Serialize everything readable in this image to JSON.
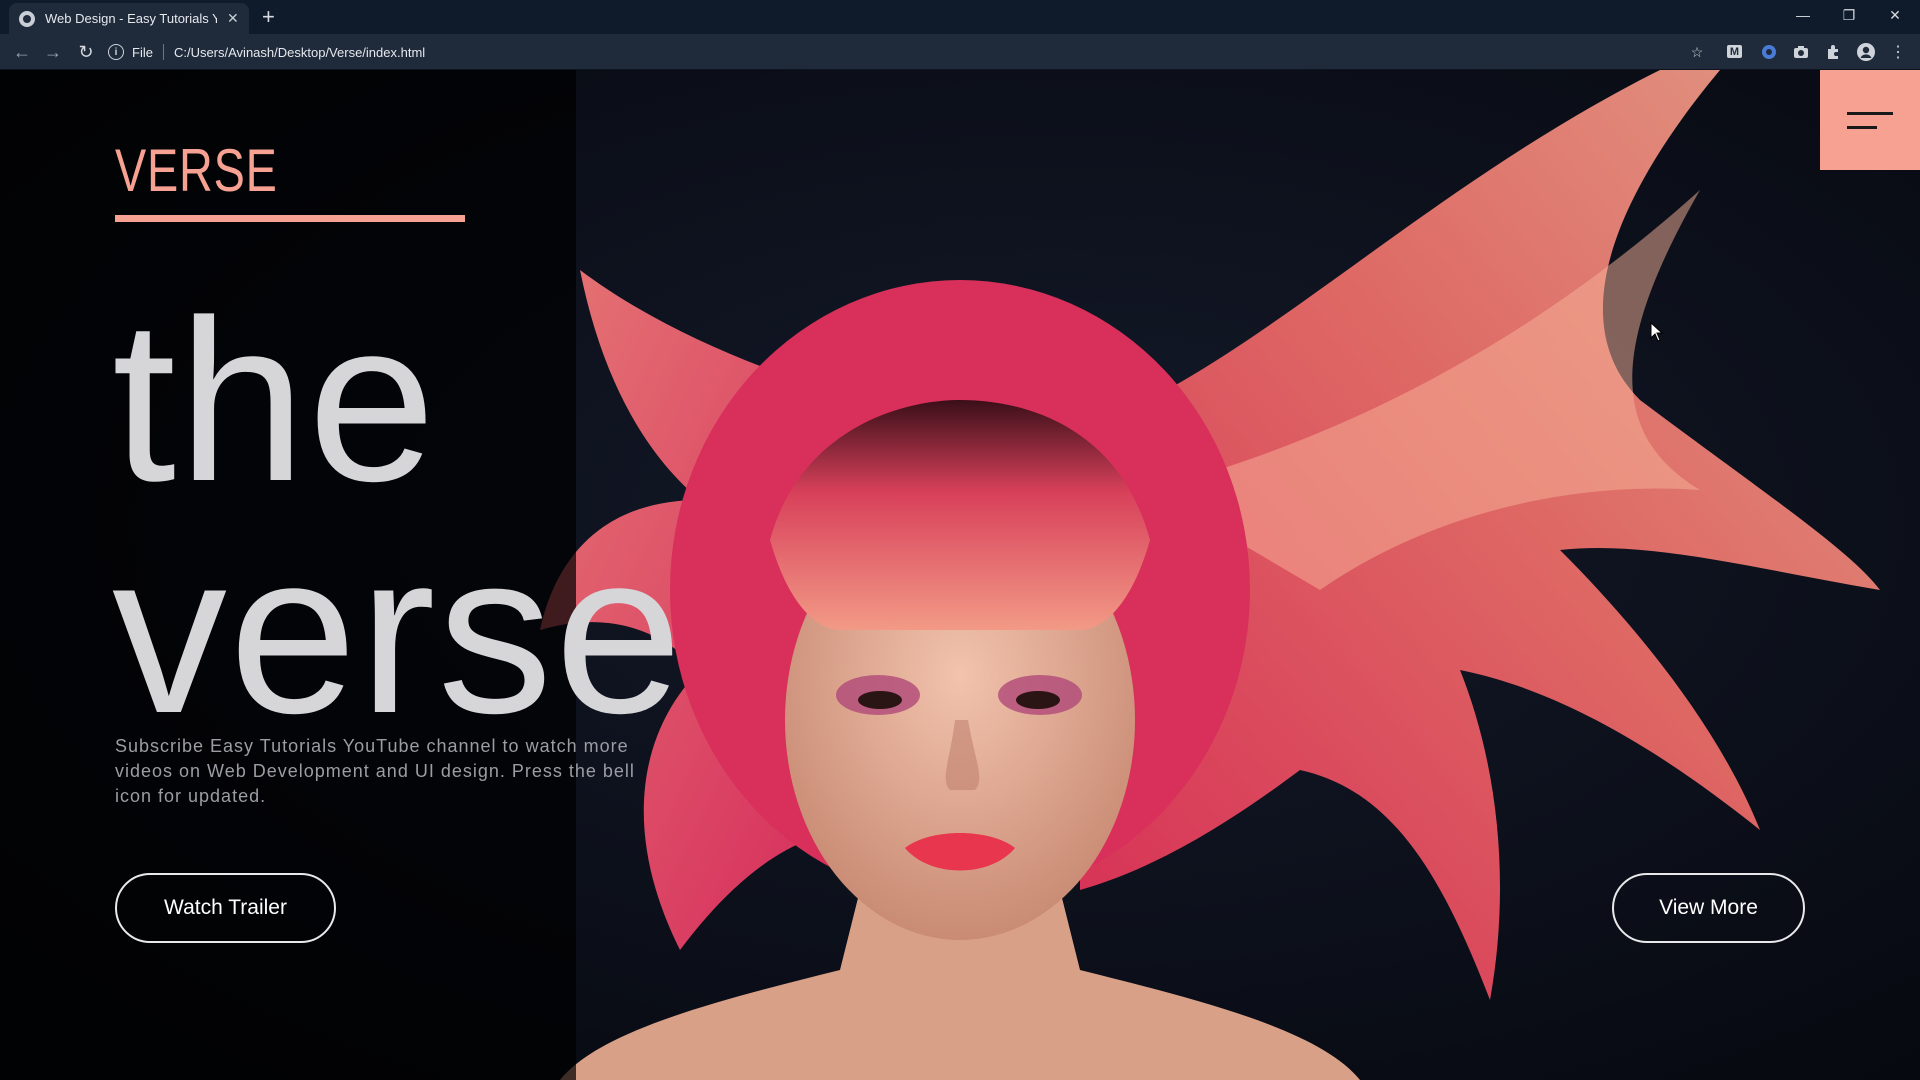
{
  "browser": {
    "tab_title": "Web Design - Easy Tutorials YouT",
    "new_tab_icon": "plus-icon",
    "address_scheme": "File",
    "address_url": "C:/Users/Avinash/Desktop/Verse/index.html",
    "window_controls": [
      "minimize",
      "restore",
      "close"
    ],
    "extension_icons": [
      "star-icon",
      "gmail-icon",
      "ext-circle-icon",
      "camera-icon",
      "puzzle-icon",
      "profile-icon",
      "kebab-menu-icon"
    ]
  },
  "hero": {
    "brand": "VERSE",
    "headline_line1": "the",
    "headline_line2": "verse",
    "subtext": "Subscribe Easy Tutorials YouTube channel to watch more videos on Web Development and UI design. Press the bell icon for updated.",
    "watch_trailer_label": "Watch Trailer",
    "view_more_label": "View More"
  },
  "colors": {
    "accent": "#f6a192",
    "headline": "#d6d6d8",
    "background": "#0b0d14",
    "chrome": "#1f2a3a"
  }
}
